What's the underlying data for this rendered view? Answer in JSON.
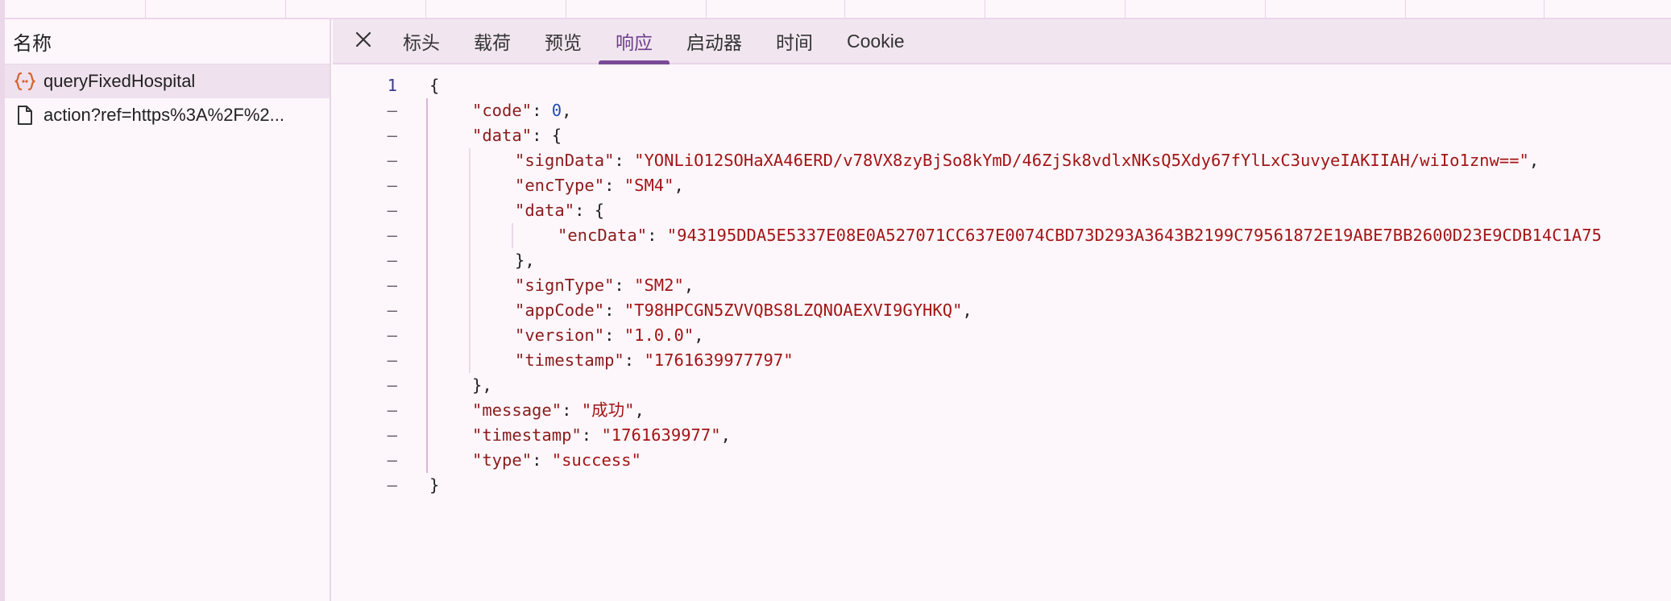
{
  "left_panel": {
    "header": "名称",
    "requests": [
      {
        "name": "queryFixedHospital",
        "icon": "json-braces-icon",
        "selected": true
      },
      {
        "name": "action?ref=https%3A%2F%2...",
        "icon": "document-icon",
        "selected": false
      }
    ]
  },
  "tabs": [
    {
      "label": "标头",
      "active": false
    },
    {
      "label": "载荷",
      "active": false
    },
    {
      "label": "预览",
      "active": false
    },
    {
      "label": "响应",
      "active": true
    },
    {
      "label": "启动器",
      "active": false
    },
    {
      "label": "时间",
      "active": false
    },
    {
      "label": "Cookie",
      "active": false
    }
  ],
  "code": {
    "line_numbers": [
      "1",
      "–",
      "–",
      "–",
      "–",
      "–",
      "–",
      "–",
      "–",
      "–",
      "–",
      "–",
      "–",
      "–",
      "–",
      "–",
      "–"
    ],
    "lines": [
      {
        "indent": 0,
        "parts": [
          {
            "t": "p",
            "v": "{"
          }
        ]
      },
      {
        "indent": 1,
        "parts": [
          {
            "t": "key",
            "v": "\"code\""
          },
          {
            "t": "p",
            "v": ": "
          },
          {
            "t": "num",
            "v": "0"
          },
          {
            "t": "p",
            "v": ","
          }
        ]
      },
      {
        "indent": 1,
        "parts": [
          {
            "t": "key",
            "v": "\"data\""
          },
          {
            "t": "p",
            "v": ": {"
          }
        ]
      },
      {
        "indent": 2,
        "parts": [
          {
            "t": "key",
            "v": "\"signData\""
          },
          {
            "t": "p",
            "v": ": "
          },
          {
            "t": "str",
            "v": "\"YONLiO12SOHaXA46ERD/v78VX8zyBjSo8kYmD/46ZjSk8vdlxNKsQ5Xdy67fYlLxC3uvyeIAKIIAH/wiIo1znw==\""
          },
          {
            "t": "p",
            "v": ","
          }
        ]
      },
      {
        "indent": 2,
        "parts": [
          {
            "t": "key",
            "v": "\"encType\""
          },
          {
            "t": "p",
            "v": ": "
          },
          {
            "t": "str",
            "v": "\"SM4\""
          },
          {
            "t": "p",
            "v": ","
          }
        ]
      },
      {
        "indent": 2,
        "parts": [
          {
            "t": "key",
            "v": "\"data\""
          },
          {
            "t": "p",
            "v": ": {"
          }
        ]
      },
      {
        "indent": 3,
        "parts": [
          {
            "t": "key",
            "v": "\"encData\""
          },
          {
            "t": "p",
            "v": ": "
          },
          {
            "t": "str",
            "v": "\"943195DDA5E5337E08E0A527071CC637E0074CBD73D293A3643B2199C79561872E19ABE7BB2600D23E9CDB14C1A75"
          }
        ]
      },
      {
        "indent": 2,
        "parts": [
          {
            "t": "p",
            "v": "},"
          }
        ]
      },
      {
        "indent": 2,
        "parts": [
          {
            "t": "key",
            "v": "\"signType\""
          },
          {
            "t": "p",
            "v": ": "
          },
          {
            "t": "str",
            "v": "\"SM2\""
          },
          {
            "t": "p",
            "v": ","
          }
        ]
      },
      {
        "indent": 2,
        "parts": [
          {
            "t": "key",
            "v": "\"appCode\""
          },
          {
            "t": "p",
            "v": ": "
          },
          {
            "t": "str",
            "v": "\"T98HPCGN5ZVVQBS8LZQNOAEXVI9GYHKQ\""
          },
          {
            "t": "p",
            "v": ","
          }
        ]
      },
      {
        "indent": 2,
        "parts": [
          {
            "t": "key",
            "v": "\"version\""
          },
          {
            "t": "p",
            "v": ": "
          },
          {
            "t": "str",
            "v": "\"1.0.0\""
          },
          {
            "t": "p",
            "v": ","
          }
        ]
      },
      {
        "indent": 2,
        "parts": [
          {
            "t": "key",
            "v": "\"timestamp\""
          },
          {
            "t": "p",
            "v": ": "
          },
          {
            "t": "str",
            "v": "\"1761639977797\""
          }
        ]
      },
      {
        "indent": 1,
        "parts": [
          {
            "t": "p",
            "v": "},"
          }
        ]
      },
      {
        "indent": 1,
        "parts": [
          {
            "t": "key",
            "v": "\"message\""
          },
          {
            "t": "p",
            "v": ": "
          },
          {
            "t": "str",
            "v": "\"成功\""
          },
          {
            "t": "p",
            "v": ","
          }
        ]
      },
      {
        "indent": 1,
        "parts": [
          {
            "t": "key",
            "v": "\"timestamp\""
          },
          {
            "t": "p",
            "v": ": "
          },
          {
            "t": "str",
            "v": "\"1761639977\""
          },
          {
            "t": "p",
            "v": ","
          }
        ]
      },
      {
        "indent": 1,
        "parts": [
          {
            "t": "key",
            "v": "\"type\""
          },
          {
            "t": "p",
            "v": ": "
          },
          {
            "t": "str",
            "v": "\"success\""
          }
        ]
      },
      {
        "indent": 0,
        "parts": [
          {
            "t": "p",
            "v": "}"
          }
        ]
      }
    ]
  },
  "colors": {
    "accent": "#7a4a97",
    "json_key": "#8b1b1b",
    "json_string": "#a31515",
    "json_number": "#1f4fb3",
    "background": "#fdf7fc"
  }
}
